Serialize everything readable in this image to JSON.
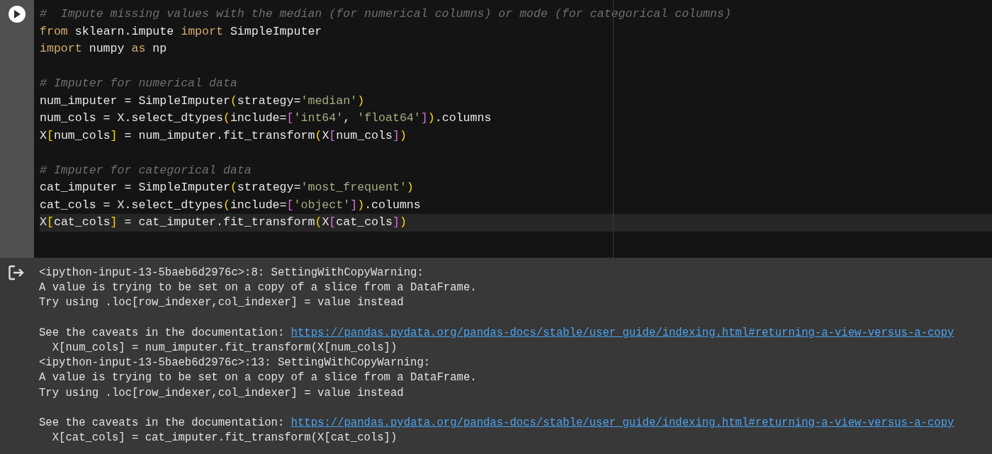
{
  "code_cell": {
    "lines": [
      {
        "kind": "code",
        "highlighted": false,
        "tokens": [
          {
            "text": "#  Impute missing values with the median (for numerical columns) or mode (for categorical columns)",
            "kind": "comment"
          }
        ]
      },
      {
        "kind": "code",
        "highlighted": false,
        "tokens": [
          {
            "text": "from",
            "kind": "keyword"
          },
          {
            "text": " sklearn.impute ",
            "kind": "plain"
          },
          {
            "text": "import",
            "kind": "keyword"
          },
          {
            "text": " SimpleImputer",
            "kind": "plain"
          }
        ]
      },
      {
        "kind": "code",
        "highlighted": false,
        "tokens": [
          {
            "text": "import",
            "kind": "keyword"
          },
          {
            "text": " numpy ",
            "kind": "plain"
          },
          {
            "text": "as",
            "kind": "keyword"
          },
          {
            "text": " np",
            "kind": "plain"
          }
        ]
      },
      {
        "kind": "blank"
      },
      {
        "kind": "code",
        "highlighted": false,
        "tokens": [
          {
            "text": "# Imputer for numerical data",
            "kind": "comment"
          }
        ]
      },
      {
        "kind": "code",
        "highlighted": false,
        "tokens": [
          {
            "text": "num_imputer = SimpleImputer",
            "kind": "plain"
          },
          {
            "text": "(",
            "kind": "bracket1"
          },
          {
            "text": "strategy=",
            "kind": "plain"
          },
          {
            "text": "'median'",
            "kind": "string"
          },
          {
            "text": ")",
            "kind": "bracket1"
          }
        ]
      },
      {
        "kind": "code",
        "highlighted": false,
        "tokens": [
          {
            "text": "num_cols = X.select_dtypes",
            "kind": "plain"
          },
          {
            "text": "(",
            "kind": "bracket1"
          },
          {
            "text": "include=",
            "kind": "plain"
          },
          {
            "text": "[",
            "kind": "bracket2"
          },
          {
            "text": "'int64'",
            "kind": "string"
          },
          {
            "text": ", ",
            "kind": "plain"
          },
          {
            "text": "'float64'",
            "kind": "string"
          },
          {
            "text": "]",
            "kind": "bracket2"
          },
          {
            "text": ")",
            "kind": "bracket1"
          },
          {
            "text": ".columns",
            "kind": "plain"
          }
        ]
      },
      {
        "kind": "code",
        "highlighted": false,
        "tokens": [
          {
            "text": "X",
            "kind": "plain"
          },
          {
            "text": "[",
            "kind": "bracket1"
          },
          {
            "text": "num_cols",
            "kind": "plain"
          },
          {
            "text": "]",
            "kind": "bracket1"
          },
          {
            "text": " = num_imputer.fit_transform",
            "kind": "plain"
          },
          {
            "text": "(",
            "kind": "bracket1"
          },
          {
            "text": "X",
            "kind": "plain"
          },
          {
            "text": "[",
            "kind": "bracket2"
          },
          {
            "text": "num_cols",
            "kind": "plain"
          },
          {
            "text": "]",
            "kind": "bracket2"
          },
          {
            "text": ")",
            "kind": "bracket1"
          }
        ]
      },
      {
        "kind": "blank"
      },
      {
        "kind": "code",
        "highlighted": false,
        "tokens": [
          {
            "text": "# Imputer for categorical data",
            "kind": "comment"
          }
        ]
      },
      {
        "kind": "code",
        "highlighted": false,
        "tokens": [
          {
            "text": "cat_imputer = SimpleImputer",
            "kind": "plain"
          },
          {
            "text": "(",
            "kind": "bracket1"
          },
          {
            "text": "strategy=",
            "kind": "plain"
          },
          {
            "text": "'most_frequent'",
            "kind": "string"
          },
          {
            "text": ")",
            "kind": "bracket1"
          }
        ]
      },
      {
        "kind": "code",
        "highlighted": false,
        "tokens": [
          {
            "text": "cat_cols = X.select_dtypes",
            "kind": "plain"
          },
          {
            "text": "(",
            "kind": "bracket1"
          },
          {
            "text": "include=",
            "kind": "plain"
          },
          {
            "text": "[",
            "kind": "bracket2"
          },
          {
            "text": "'object'",
            "kind": "string"
          },
          {
            "text": "]",
            "kind": "bracket2"
          },
          {
            "text": ")",
            "kind": "bracket1"
          },
          {
            "text": ".columns",
            "kind": "plain"
          }
        ]
      },
      {
        "kind": "code",
        "highlighted": true,
        "tokens": [
          {
            "text": "X",
            "kind": "plain"
          },
          {
            "text": "[",
            "kind": "bracket1"
          },
          {
            "text": "cat_cols",
            "kind": "plain"
          },
          {
            "text": "]",
            "kind": "bracket1"
          },
          {
            "text": " = cat_imputer.fit_transform",
            "kind": "plain"
          },
          {
            "text": "(",
            "kind": "bracket1"
          },
          {
            "text": "X",
            "kind": "plain"
          },
          {
            "text": "[",
            "kind": "bracket2"
          },
          {
            "text": "cat_cols",
            "kind": "plain"
          },
          {
            "text": "]",
            "kind": "bracket2"
          },
          {
            "text": ")",
            "kind": "bracket1"
          }
        ]
      }
    ]
  },
  "output": {
    "lines": [
      {
        "kind": "text",
        "text": "<ipython-input-13-5baeb6d2976c>:8: SettingWithCopyWarning:"
      },
      {
        "kind": "text",
        "text": "A value is trying to be set on a copy of a slice from a DataFrame."
      },
      {
        "kind": "text",
        "text": "Try using .loc[row_indexer,col_indexer] = value instead"
      },
      {
        "kind": "blank"
      },
      {
        "kind": "link",
        "text": "See the caveats in the documentation: ",
        "link": "https://pandas.pydata.org/pandas-docs/stable/user_guide/indexing.html#returning-a-view-versus-a-copy"
      },
      {
        "kind": "text",
        "text": "  X[num_cols] = num_imputer.fit_transform(X[num_cols])"
      },
      {
        "kind": "text",
        "text": "<ipython-input-13-5baeb6d2976c>:13: SettingWithCopyWarning:"
      },
      {
        "kind": "text",
        "text": "A value is trying to be set on a copy of a slice from a DataFrame."
      },
      {
        "kind": "text",
        "text": "Try using .loc[row_indexer,col_indexer] = value instead"
      },
      {
        "kind": "blank"
      },
      {
        "kind": "link",
        "text": "See the caveats in the documentation: ",
        "link": "https://pandas.pydata.org/pandas-docs/stable/user_guide/indexing.html#returning-a-view-versus-a-copy"
      },
      {
        "kind": "text",
        "text": "  X[cat_cols] = cat_imputer.fit_transform(X[cat_cols])"
      }
    ]
  }
}
